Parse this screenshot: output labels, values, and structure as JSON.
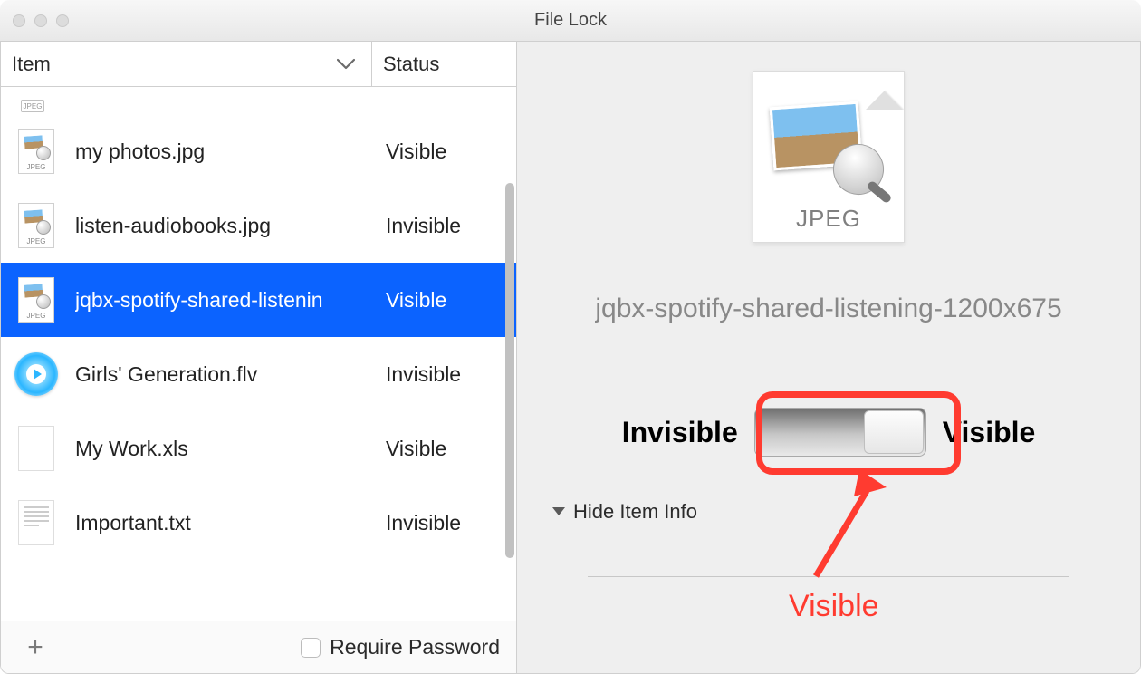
{
  "window": {
    "title": "File Lock"
  },
  "columns": {
    "item": "Item",
    "status": "Status"
  },
  "partial_top_badge": "JPEG",
  "rows": [
    {
      "name": "my photos.jpg",
      "status": "Visible",
      "icon": "jpeg",
      "selected": false
    },
    {
      "name": "listen-audiobooks.jpg",
      "status": "Invisible",
      "icon": "jpeg",
      "selected": false
    },
    {
      "name": "jqbx-spotify-shared-listenin",
      "status": "Visible",
      "icon": "jpeg",
      "selected": true
    },
    {
      "name": "Girls' Generation.flv",
      "status": "Invisible",
      "icon": "video",
      "selected": false
    },
    {
      "name": "My Work.xls",
      "status": "Visible",
      "icon": "blank",
      "selected": false
    },
    {
      "name": "Important.txt",
      "status": "Invisible",
      "icon": "txt",
      "selected": false
    }
  ],
  "footer": {
    "require_password": "Require Password"
  },
  "detail": {
    "filetype_label": "JPEG",
    "filename": "jqbx-spotify-shared-listening-1200x675",
    "toggle_left": "Invisible",
    "toggle_right": "Visible",
    "hide_item_info": "Hide Item Info"
  },
  "annotation": {
    "label": "Visible"
  },
  "colors": {
    "highlight": "#ff3b30",
    "selection": "#0b63ff"
  }
}
